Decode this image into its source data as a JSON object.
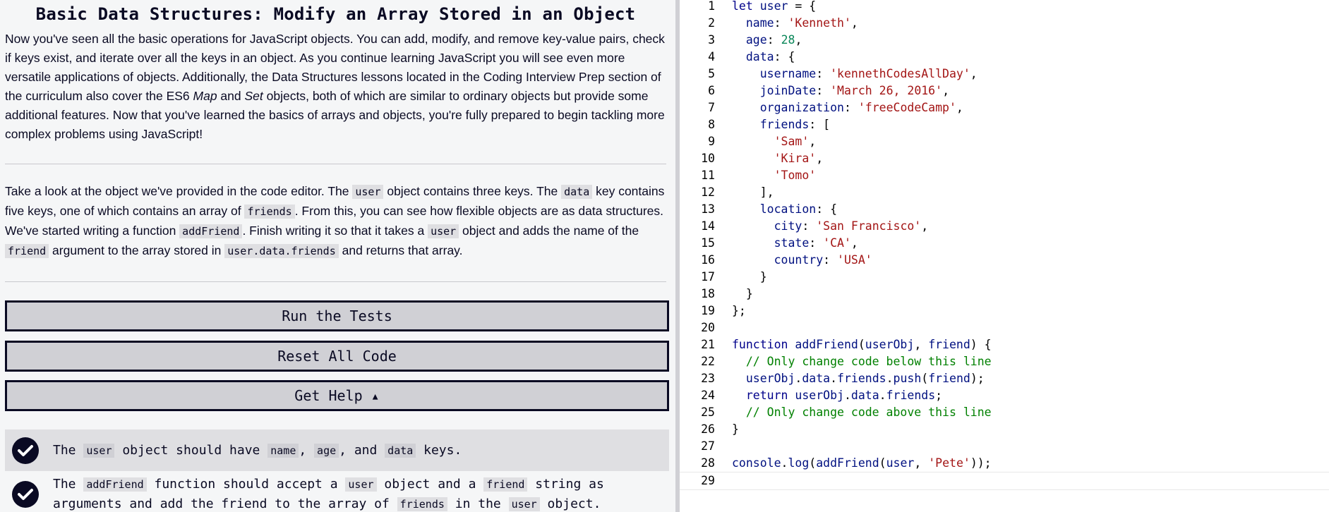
{
  "lesson": {
    "title": "Basic Data Structures: Modify an Array Stored in an Object",
    "desc_parts": [
      "Now you've seen all the basic operations for JavaScript objects. You can add, modify, and remove key-value pairs, check if keys exist, and iterate over all the keys in an object. As you continue learning JavaScript you will see even more versatile applications of objects. Additionally, the Data Structures lessons located in the Coding Interview Prep section of the curriculum also cover the ES6 ",
      "Map",
      " and ",
      "Set",
      " objects, both of which are similar to ordinary objects but provide some additional features. Now that you've learned the basics of arrays and objects, you're fully prepared to begin tackling more complex problems using JavaScript!"
    ],
    "instr": [
      "Take a look at the object we've provided in the code editor. The ",
      "user",
      " object contains three keys. The ",
      "data",
      " key contains five keys, one of which contains an array of ",
      "friends",
      ". From this, you can see how flexible objects are as data structures. We've started writing a function ",
      "addFriend",
      ". Finish writing it so that it takes a ",
      "user",
      " object and adds the name of the ",
      "friend",
      " argument to the array stored in ",
      "user.data.friends",
      " and returns that array."
    ]
  },
  "buttons": {
    "run": "Run the Tests",
    "reset": "Reset All Code",
    "help": "Get Help ▴"
  },
  "tests": [
    {
      "passed": true,
      "parts": [
        "The ",
        "user",
        " object should have ",
        "name",
        ", ",
        "age",
        ", and ",
        "data",
        " keys."
      ]
    },
    {
      "passed": true,
      "parts": [
        "The ",
        "addFriend",
        " function should accept a ",
        "user",
        " object and a ",
        "friend",
        " string as arguments and add the friend to the array of ",
        "friends",
        " in the ",
        "user",
        " object."
      ]
    }
  ],
  "editor": {
    "lines": [
      {
        "n": "1",
        "t": "let user = {"
      },
      {
        "n": "2",
        "t": "  name: 'Kenneth',"
      },
      {
        "n": "3",
        "t": "  age: 28,"
      },
      {
        "n": "4",
        "t": "  data: {"
      },
      {
        "n": "5",
        "t": "    username: 'kennethCodesAllDay',"
      },
      {
        "n": "6",
        "t": "    joinDate: 'March 26, 2016',"
      },
      {
        "n": "7",
        "t": "    organization: 'freeCodeCamp',"
      },
      {
        "n": "8",
        "t": "    friends: ["
      },
      {
        "n": "9",
        "t": "      'Sam',"
      },
      {
        "n": "10",
        "t": "      'Kira',"
      },
      {
        "n": "11",
        "t": "      'Tomo'"
      },
      {
        "n": "12",
        "t": "    ],"
      },
      {
        "n": "13",
        "t": "    location: {"
      },
      {
        "n": "14",
        "t": "      city: 'San Francisco',"
      },
      {
        "n": "15",
        "t": "      state: 'CA',"
      },
      {
        "n": "16",
        "t": "      country: 'USA'"
      },
      {
        "n": "17",
        "t": "    }"
      },
      {
        "n": "18",
        "t": "  }"
      },
      {
        "n": "19",
        "t": "};"
      },
      {
        "n": "20",
        "t": ""
      },
      {
        "n": "21",
        "t": "function addFriend(userObj, friend) {"
      },
      {
        "n": "22",
        "t": "  // Only change code below this line"
      },
      {
        "n": "23",
        "t": "  userObj.data.friends.push(friend);"
      },
      {
        "n": "24",
        "t": "  return userObj.data.friends;"
      },
      {
        "n": "25",
        "t": "  // Only change code above this line"
      },
      {
        "n": "26",
        "t": "}"
      },
      {
        "n": "27",
        "t": ""
      },
      {
        "n": "28",
        "t": "console.log(addFriend(user, 'Pete'));"
      },
      {
        "n": "29",
        "t": ""
      }
    ]
  },
  "colors": {
    "keyword": "#00008b",
    "string": "#a31515",
    "number": "#098658",
    "property": "#001080",
    "comment": "#008000"
  }
}
